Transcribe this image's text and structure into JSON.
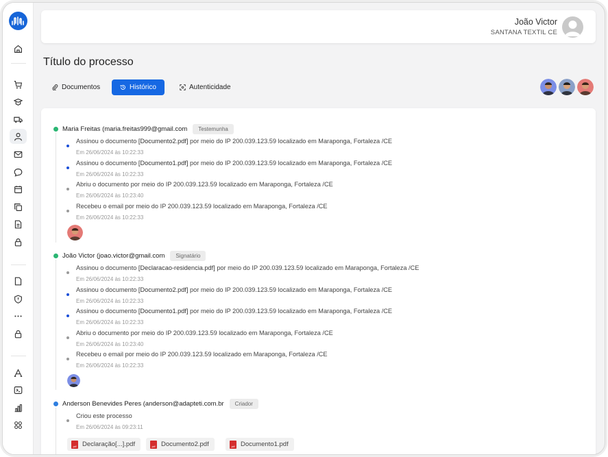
{
  "header": {
    "user_name": "João Victor",
    "company": "SANTANA TEXTIL CE"
  },
  "page": {
    "title": "Título do processo"
  },
  "tabs": [
    {
      "label": "Documentos",
      "icon": "paperclip-icon",
      "active": false
    },
    {
      "label": "Histórico",
      "icon": "history-icon",
      "active": true
    },
    {
      "label": "Autenticidade",
      "icon": "scan-icon",
      "active": false
    }
  ],
  "sidebar": {
    "icons": [
      "home-icon",
      "cart-icon",
      "graduation-cap-icon",
      "truck-icon",
      "user-icon",
      "mail-icon",
      "chat-icon",
      "calendar-icon",
      "copy-icon",
      "file-text-icon",
      "lock-icon",
      "file-icon",
      "shield-icon",
      "more-dots-icon",
      "lock-icon",
      "text-font-icon",
      "terminal-icon",
      "bar-chart-icon",
      "apps-icon"
    ]
  },
  "colors": {
    "accent": "#1668e3",
    "dot_green": "#2bb673",
    "dot_blue": "#2f7fe0",
    "dot_darkblue": "#1b4fd8",
    "dot_gray": "#9a9a9a"
  },
  "history": [
    {
      "signer": "Maria Freitas (maria.freitas999@gmail.com",
      "role": "Testemunha",
      "events": [
        {
          "prefix": "Assinou o documento ",
          "doc": "[Documento2.pdf]",
          "suffix": " por meio do IP 200.039.123.59 localizado em Maraponga, Fortaleza /CE",
          "time": "Em 26/06/2024 às 10:22:33"
        },
        {
          "prefix": "Assinou o documento ",
          "doc": "[Documento1.pdf]",
          "suffix": " por meio do IP 200.039.123.59 localizado em Maraponga, Fortaleza /CE",
          "time": "Em 26/06/2024 às 10:22:33"
        },
        {
          "prefix": "Abriu o documento por meio do IP 200.039.123.59 localizado em Maraponga, Fortaleza /CE",
          "doc": "",
          "suffix": "",
          "time": "Em 26/06/2024 às 10:23:40"
        },
        {
          "prefix": "Recebeu o email por meio do IP 200.039.123.59 localizado em Maraponga, Fortaleza /CE",
          "doc": "",
          "suffix": "",
          "time": "Em 26/06/2024 às 10:22:33"
        }
      ]
    },
    {
      "signer": "João Victor (joao.victor@gmail.com",
      "role": "Signatário",
      "events": [
        {
          "prefix": "Assinou o documento ",
          "doc": "[Declaracao-residencia.pdf]",
          "suffix": " por meio do IP 200.039.123.59 localizado em Maraponga, Fortaleza /CE",
          "time": "Em 26/06/2024 às 10:22:33"
        },
        {
          "prefix": "Assinou o documento ",
          "doc": "[Documento2.pdf]",
          "suffix": " por meio do IP 200.039.123.59 localizado em Maraponga, Fortaleza /CE",
          "time": "Em 26/06/2024 às 10:22:33"
        },
        {
          "prefix": "Assinou o documento ",
          "doc": "[Documento1.pdf]",
          "suffix": " por meio do IP 200.039.123.59 localizado em Maraponga, Fortaleza /CE",
          "time": "Em 26/06/2024 às 10:22:33"
        },
        {
          "prefix": "Abriu o documento por meio do IP 200.039.123.59 localizado em Maraponga, Fortaleza /CE",
          "doc": "",
          "suffix": "",
          "time": "Em 26/06/2024 às 10:23:40"
        },
        {
          "prefix": "Recebeu o email por meio do IP 200.039.123.59 localizado em Maraponga, Fortaleza /CE",
          "doc": "",
          "suffix": "",
          "time": "Em 26/06/2024 às 10:22:33"
        }
      ]
    },
    {
      "signer": "Anderson Benevides Peres (anderson@adapteti.com.br",
      "role": "Criador",
      "events": [
        {
          "prefix": "Criou este processo",
          "doc": "",
          "suffix": "",
          "time": "Em 26/06/2024 às 09:23:11"
        }
      ]
    }
  ],
  "documents": [
    "Declaração[...].pdf",
    "Documento2.pdf",
    "Documento1.pdf"
  ]
}
